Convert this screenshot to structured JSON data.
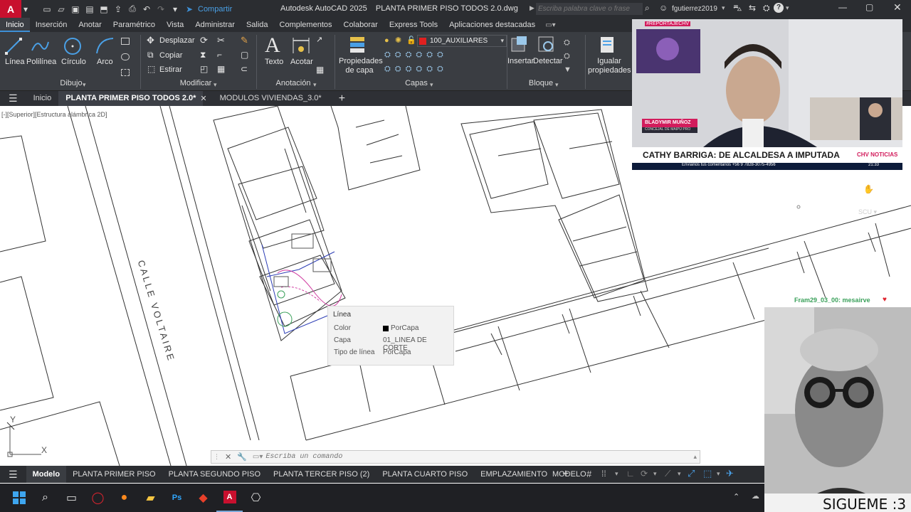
{
  "app": {
    "logo_letter": "A",
    "window_title": "Autodesk AutoCAD 2025    PLANTA PRIMER PISO TODOS 2.0.dwg",
    "share_label": "Compartir",
    "search_placeholder": "Escriba palabra clave o frase",
    "user_name": "fgutierrez2019",
    "accent_color": "#c8102e"
  },
  "menu": {
    "items": [
      "Inicio",
      "Inserción",
      "Anotar",
      "Paramétrico",
      "Vista",
      "Administrar",
      "Salida",
      "Complementos",
      "Colaborar",
      "Express Tools",
      "Aplicaciones destacadas"
    ]
  },
  "ribbon": {
    "draw": {
      "title": "Dibujo",
      "line": "Línea",
      "polyline": "Polilínea",
      "circle": "Círculo",
      "arc": "Arco"
    },
    "modify": {
      "title": "Modificar",
      "move": "Desplazar",
      "copy": "Copiar",
      "stretch": "Estirar"
    },
    "annotation": {
      "title": "Anotación",
      "text": "Texto",
      "dimension": "Acotar"
    },
    "layers": {
      "title": "Capas",
      "properties": "Propiedades de capa",
      "current_layer": "100_AUXILIARES"
    },
    "block": {
      "title": "Bloque",
      "insert": "Insertar",
      "detect": "Detectar"
    },
    "match": {
      "label": "Igualar propiedades"
    }
  },
  "doctabs": {
    "home": "Inicio",
    "active": "PLANTA PRIMER PISO TODOS 2.0*",
    "second": "MODULOS VIVIENDAS_3.0*"
  },
  "viewport": {
    "label": "[-][Superior][Estructura alámbrica 2D]",
    "street_label": "CALLE VOLTAIRE",
    "ucs_x": "X",
    "ucs_y": "Y"
  },
  "tooltip": {
    "title": "Línea",
    "rows": [
      {
        "key": "Color",
        "value": "PorCapa"
      },
      {
        "key": "Capa",
        "value": "01_LINEA DE CORTE"
      },
      {
        "key": "Tipo de línea",
        "value": "PorCapa"
      }
    ]
  },
  "command": {
    "placeholder": "Escriba un comando"
  },
  "layouts": {
    "items": [
      "Modelo",
      "PLANTA PRIMER PISO",
      "PLANTA SEGUNDO PISO",
      "PLANTA TERCER PISO (2)",
      "PLANTA CUARTO PISO",
      "EMPLAZAMIENTO"
    ]
  },
  "status": {
    "model_label": "MODELO"
  },
  "overlay": {
    "news_tag": "#REPORTAJECHV",
    "person_name": "BLADYMIR MUÑOZ",
    "person_role": "CONCEJAL DE MAIPÚ PRO",
    "headline": "CATHY BARRIGA: DE ALCALDESA A IMPUTADA",
    "news_brand": "CHV NOTICIAS",
    "news_time": "21:33",
    "ticker": "Envíanos tus comentarios +56 9 7828-3075-4956",
    "chat_message": "Fram29_03_00: mesairve",
    "follow_text": "SIGUEME :3"
  }
}
